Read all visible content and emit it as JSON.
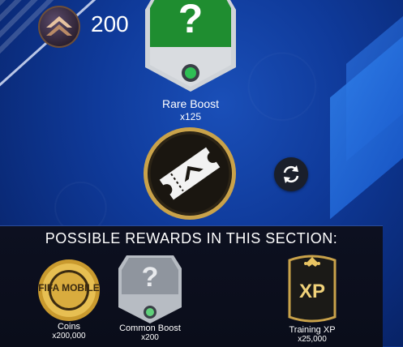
{
  "header": {
    "coin_amount": "200",
    "coin_icon": "tier-chevron-icon"
  },
  "featured": {
    "name": "Rare Boost",
    "quantity": "x125",
    "icon": "question-mark-icon",
    "colors": {
      "accent": "#1e8a2e",
      "frame": "#c9ccd1"
    }
  },
  "action": {
    "ticket_icon": "ticket-icon",
    "refresh_icon": "refresh-icon",
    "ticket_ring": "#c9a24a"
  },
  "rewards_panel": {
    "title": "POSSIBLE REWARDS IN THIS SECTION:",
    "items": [
      {
        "label": "Coins",
        "quantity": "x200,000",
        "icon": "fifa-mobile-coin-icon",
        "logo_text": "FIFA MOBILE"
      },
      {
        "label": "Common Boost",
        "quantity": "x200",
        "icon": "question-mark-icon"
      },
      {
        "label": "Training XP",
        "quantity": "x25,000",
        "icon": "xp-card-icon",
        "logo_text": "XP"
      }
    ]
  }
}
